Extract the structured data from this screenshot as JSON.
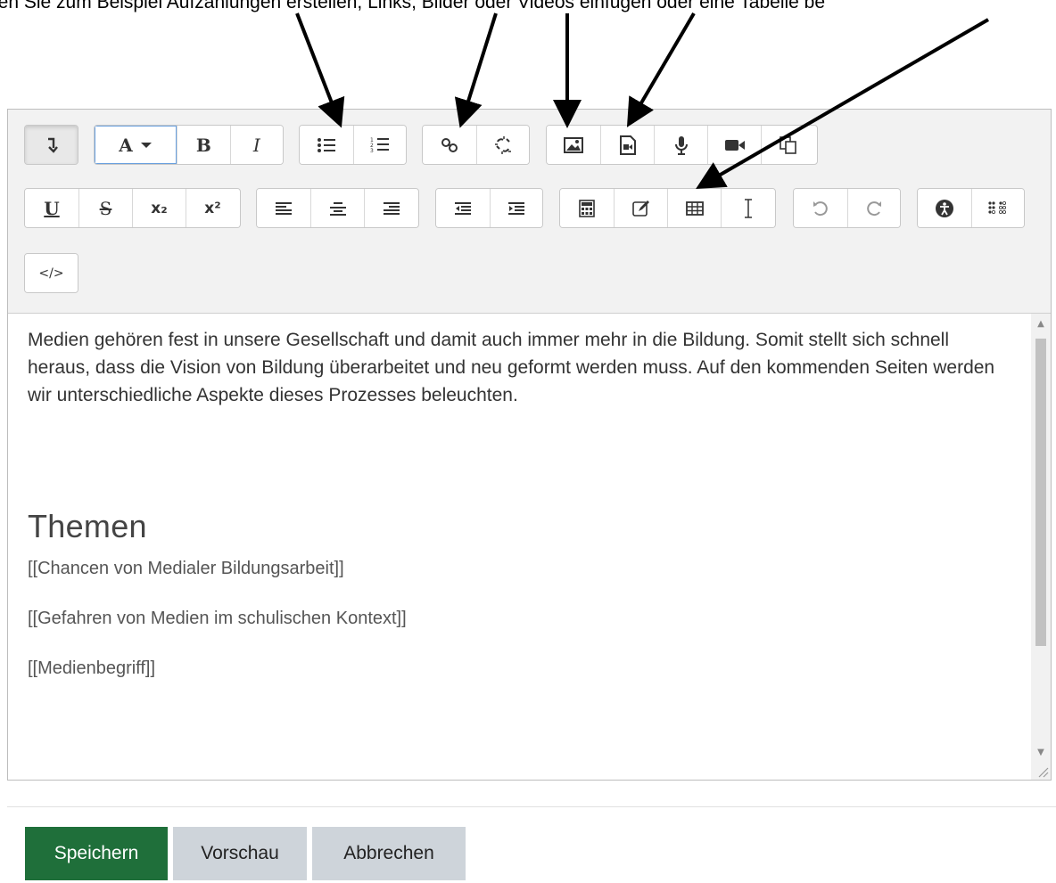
{
  "caption": {
    "text": "nen Sie zum Beispiel Aufzählungen erstellen, Links, Bilder oder Videos einfügen oder eine Tabelle be"
  },
  "toolbar": {
    "font_label": "A",
    "bold_label": "B",
    "italic_label": "I",
    "underline_label": "U",
    "strike_label": "S",
    "subscript_label": "x₂",
    "superscript_label": "x²",
    "html_label": "</>"
  },
  "content": {
    "intro": "Medien gehören fest in unsere Gesellschaft und damit auch immer mehr in die Bildung. Somit stellt sich schnell heraus, dass die Vision von Bildung überarbeitet und neu geformt werden muss. Auf den kommenden Seiten werden wir unterschiedliche Aspekte dieses Prozesses beleuchten.",
    "heading": "Themen",
    "links": [
      "[[Chancen von Medialer Bildungsarbeit]]",
      "[[Gefahren von Medien im schulischen Kontext]]",
      "[[Medienbegriff]]"
    ]
  },
  "actions": {
    "save_label": "Speichern",
    "preview_label": "Vorschau",
    "cancel_label": "Abbrechen"
  },
  "colors": {
    "save_button": "#1f6f3a",
    "secondary_button": "#ced4da",
    "toolbar_background": "#f2f2f2"
  }
}
